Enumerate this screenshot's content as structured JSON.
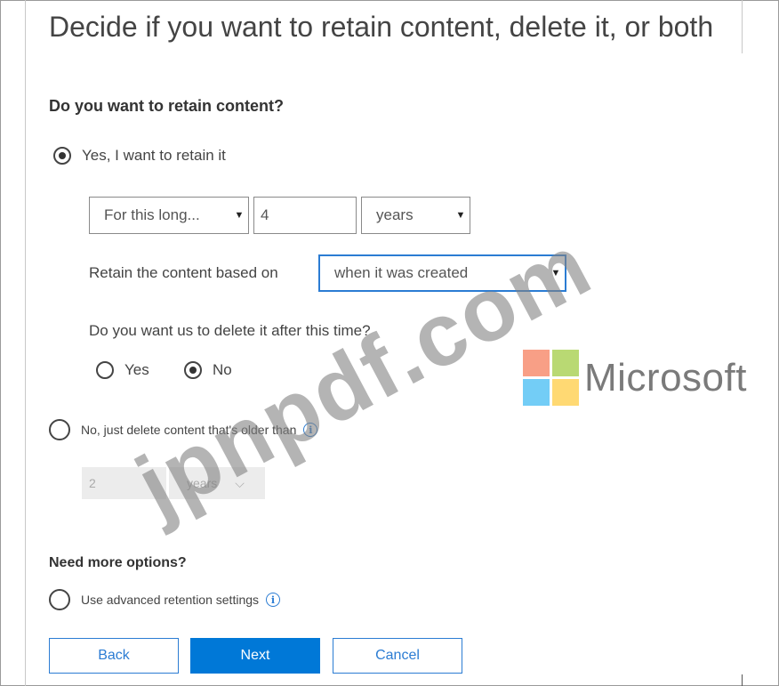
{
  "page_title": "Decide if you want to retain content, delete it, or both",
  "retain_section": {
    "heading": "Do you want to retain content?",
    "yes_option": {
      "label": "Yes, I want to retain it",
      "checked": true
    },
    "period_dropdown": "For this long...",
    "period_value": "4",
    "unit_dropdown": "years",
    "based_on_label": "Retain the content based on",
    "based_on_dropdown": "when it was created",
    "delete_question": "Do you want us to delete it after this time?",
    "delete_yes": {
      "label": "Yes",
      "checked": false
    },
    "delete_no": {
      "label": "No",
      "checked": true
    },
    "no_option": {
      "label": "No, just delete content that's older than",
      "checked": false
    },
    "disabled_value": "2",
    "disabled_unit": "years"
  },
  "more_options": {
    "heading": "Need more options?",
    "advanced": {
      "label": "Use advanced retention settings",
      "checked": false
    }
  },
  "buttons": {
    "back": "Back",
    "next": "Next",
    "cancel": "Cancel"
  },
  "icons": {
    "dropdown_arrow": "▼",
    "chevron_down": "⌵",
    "info": "i"
  },
  "logo": {
    "text": "Microsoft",
    "colors": [
      "#f25022",
      "#7fba00",
      "#00a4ef",
      "#ffb900"
    ]
  },
  "watermark": "jpnpdf.com",
  "colors": {
    "accent": "#0078d7",
    "button_text": "#2b7cd3"
  }
}
